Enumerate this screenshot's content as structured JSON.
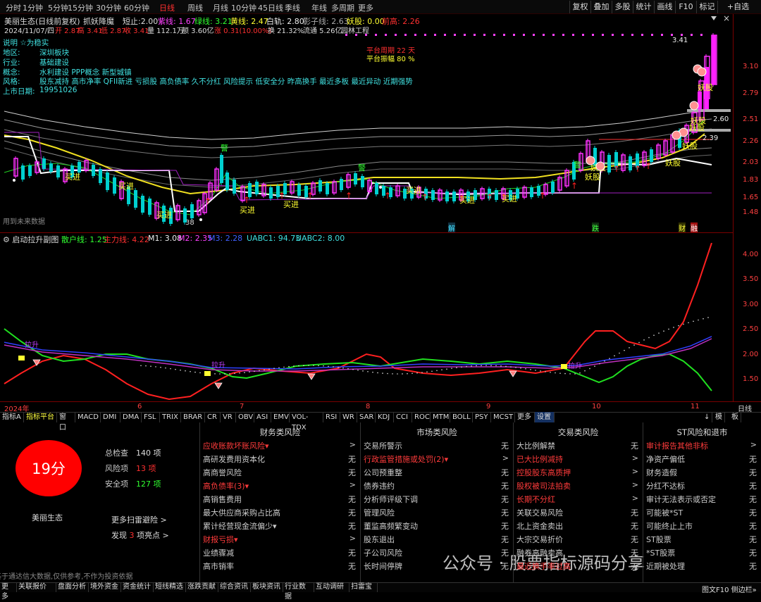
{
  "period_tabs": [
    "分时",
    "1分钟",
    "5分钟",
    "15分钟",
    "30分钟",
    "60分钟",
    "日线",
    "周线",
    "月线",
    "10分钟",
    "45日线",
    "季线",
    "年线",
    "多周期",
    "更多"
  ],
  "active_period": "日线",
  "right_buttons": [
    "复权",
    "叠加",
    "多股",
    "统计",
    "画线",
    "F10",
    "标记",
    "+自选"
  ],
  "header": {
    "name": "美丽生态(日线前复权)",
    "indicator": "抓妖降魔",
    "short": "短止:2.00",
    "l1": "紫线: 1.67",
    "l2": "绿线: 3.21",
    "l3": "黄线: 2.47",
    "l4": "白轨: 2.80",
    "l5": "影子线: 2.63",
    "l6": "妖股: 0.00",
    "l7": "前高: 2.26"
  },
  "quote": {
    "date": "2024/11/07/四",
    "open": "开 2.87",
    "high": "高 3.41",
    "low": "低 2.87",
    "close": "收 3.41",
    "vol": "量 112.1万",
    "amount": "额 3.60亿",
    "chg": "涨 0.31(10.00%)",
    "turn": "换 21.32%",
    "flow": "流通 5.26亿",
    "industry": "园林工程"
  },
  "info": {
    "r1": "说明  ☆为稳实",
    "r2k": "地区:",
    "r2v": "深圳板块",
    "r3k": "行业:",
    "r3v": "基础建设",
    "r4k": "概念:",
    "r4v": "水利建设 PPP概念 新型城镇",
    "r5k": "风格:",
    "r5v": "股东减持 高市净率 QFII新进 亏损股 高负债率 久不分红 风险提示 低安全分 昨高换手 最近多板 最近异动 近期强势",
    "r6k": "上市日期:",
    "r6v": "19951026"
  },
  "platform": {
    "a": "平台周期 22 天",
    "b": "平台振幅 80 %"
  },
  "price_axis": [
    "3.41",
    "3.10",
    "2.79",
    "2.51",
    "2.26",
    "2.03",
    "1.83",
    "1.65",
    "1.48"
  ],
  "price_points": [
    {
      "label": "2.60"
    },
    {
      "label": "2.39"
    }
  ],
  "chart_labels": {
    "buy": "买进",
    "demon": "妖股",
    "warn": "警",
    "b38": "38",
    "future": "用到未来数据",
    "jie": "解",
    "die": "跌",
    "cai": "财",
    "rong": "融"
  },
  "sub": {
    "title": "启动拉升副图",
    "s1": "散户线: 1.25",
    "s2": "主力线: 4.22",
    "s3": "M1: 3.08",
    "s4": "M2: 2.35",
    "s5": "M3: 2.28",
    "s6": "UABC1: 94.73",
    "s7": "UABC2: 8.00",
    "lift": "拉升"
  },
  "sub_axis": [
    "4.00",
    "3.50",
    "3.00",
    "2.50",
    "2.00",
    "1.50"
  ],
  "date_axis": [
    "2024年",
    "6",
    "7",
    "8",
    "9",
    "10",
    "11"
  ],
  "date_axis_right": "日线",
  "indicator_tabs": [
    "指标A",
    "指标平台",
    "窗口",
    "MACD",
    "DMI",
    "DMA",
    "FSL",
    "TRIX",
    "BRAR",
    "CR",
    "VR",
    "OBV",
    "ASI",
    "EMV",
    "VOL-TDX",
    "RSI",
    "WR",
    "SAR",
    "KDJ",
    "CCI",
    "ROC",
    "MTM",
    "BOLL",
    "PSY",
    "MCST",
    "更多",
    "设置"
  ],
  "indicator_right": [
    "↓",
    "模",
    "板"
  ],
  "score": {
    "value": "19分",
    "name": "美丽生态",
    "total_k": "总检查",
    "total_v": "140 项",
    "risk_k": "风险项",
    "risk_v": "13 项",
    "safe_k": "安全项",
    "safe_v": "127 项",
    "more": "更多扫雷避险 >",
    "find_a": "发现",
    "find_n": "3",
    "find_b": "项亮点 >",
    "disclaimer": "基于通达信大数据,仅供参考,不作为投资依据"
  },
  "cat_finance": {
    "title": "财务类风险",
    "items": [
      {
        "t": "应收账款坏账风险▾",
        "v": ">",
        "red": true
      },
      {
        "t": "高研发费用资本化",
        "v": "无"
      },
      {
        "t": "高商誉风险",
        "v": "无"
      },
      {
        "t": "高负债率(3)▾",
        "v": ">",
        "red": true
      },
      {
        "t": "高销售费用",
        "v": "无"
      },
      {
        "t": "最大供应商采购占比高",
        "v": "无"
      },
      {
        "t": "累计经营现金流偏少▾",
        "v": "无"
      },
      {
        "t": "财报亏损▾",
        "v": ">",
        "red": true
      },
      {
        "t": "业绩骤减",
        "v": "无"
      },
      {
        "t": "高市销率",
        "v": "无"
      }
    ]
  },
  "cat_market": {
    "title": "市场类风险",
    "items": [
      {
        "t": "交易所警示",
        "v": "无"
      },
      {
        "t": "行政监管措施或处罚(2)▾",
        "v": ">",
        "red": true
      },
      {
        "t": "公司预重整",
        "v": "无"
      },
      {
        "t": "债券违约",
        "v": "无"
      },
      {
        "t": "分析师评级下调",
        "v": "无"
      },
      {
        "t": "管理风险",
        "v": "无"
      },
      {
        "t": "董监高频繁变动",
        "v": "无"
      },
      {
        "t": "股东退出",
        "v": "无"
      },
      {
        "t": "子公司风险",
        "v": "无"
      },
      {
        "t": "长时间停牌",
        "v": "无"
      }
    ]
  },
  "cat_trade": {
    "title": "交易类风险",
    "items": [
      {
        "t": "大比例解禁",
        "v": "无"
      },
      {
        "t": "已大比例减持",
        "v": ">",
        "red": true
      },
      {
        "t": "控股股东高质押",
        "v": ">",
        "red": true
      },
      {
        "t": "股权被司法拍卖",
        "v": ">",
        "red": true
      },
      {
        "t": "长期不分红",
        "v": ">",
        "red": true
      },
      {
        "t": "关联交易风险",
        "v": "无"
      },
      {
        "t": "北上资金卖出",
        "v": "无"
      },
      {
        "t": "大宗交易折价",
        "v": "无"
      },
      {
        "t": "融券高融卖高",
        "v": "无"
      },
      {
        "t": "最近换手率过高",
        "v": "无",
        "red": true
      }
    ]
  },
  "cat_st": {
    "title": "ST风险和退市",
    "items": [
      {
        "t": "审计报告其他非标",
        "v": ">",
        "red": true
      },
      {
        "t": "净资产偏低",
        "v": "无"
      },
      {
        "t": "财务造假",
        "v": "无"
      },
      {
        "t": "分红不达标",
        "v": "无"
      },
      {
        "t": "审计无法表示或否定",
        "v": "无"
      },
      {
        "t": "可能被*ST",
        "v": "无"
      },
      {
        "t": "可能终止上市",
        "v": "无"
      },
      {
        "t": "ST股票",
        "v": "无"
      },
      {
        "t": "*ST股票",
        "v": "无"
      },
      {
        "t": "近期被处理",
        "v": "无"
      }
    ]
  },
  "watermark": "公众号 · 股票指标源码分享",
  "bottom_tabs": [
    "更多",
    "关联报价",
    "盘面分析",
    "境外资金",
    "资金统计",
    "短线精选",
    "涨跌贡献",
    "综合资讯",
    "板块资讯",
    "行业数据",
    "互动调研",
    "扫雷宝"
  ],
  "bottom_right": "图文F10 侧边栏»",
  "colors": {
    "up": "#ff3030",
    "down": "#00e0e0",
    "yellow": "#f0e020",
    "green": "#20e020",
    "magenta": "#ff20ff"
  }
}
